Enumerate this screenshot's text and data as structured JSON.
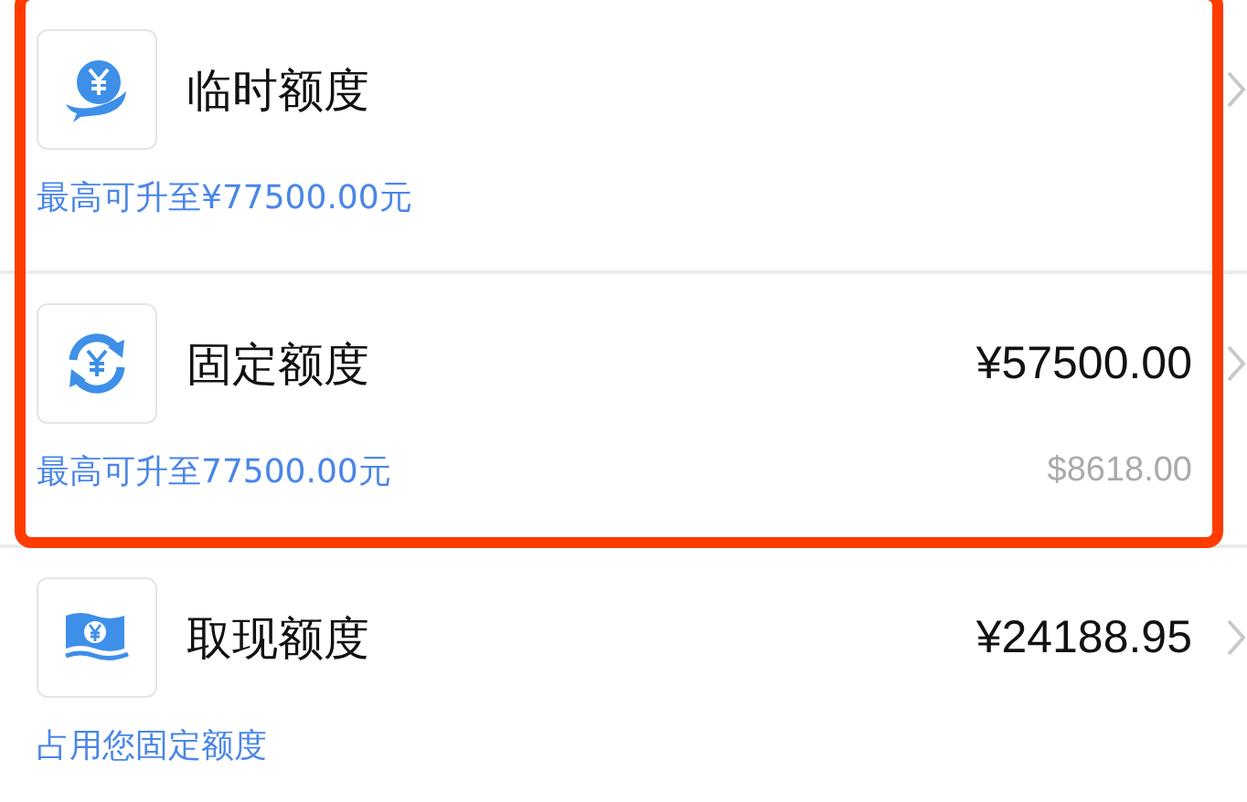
{
  "rows": [
    {
      "title": "临时额度",
      "note": "最高可升至¥77500.00元",
      "highlighted": true
    },
    {
      "title": "固定额度",
      "amount": "¥57500.00",
      "note": "最高可升至77500.00元",
      "secondary": "$8618.00",
      "highlighted": true
    },
    {
      "title": "取现额度",
      "amount": "¥24188.95",
      "note": "占用您固定额度",
      "highlighted": false
    }
  ]
}
